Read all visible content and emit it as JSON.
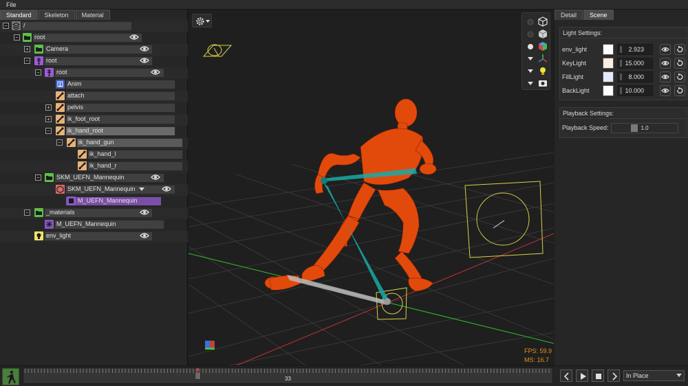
{
  "menu": {
    "file": "File"
  },
  "left_panel": {
    "tabs": [
      "Standard",
      "Skeleton",
      "Material"
    ],
    "tree": [
      {
        "label": "/",
        "icon": "layers-icon",
        "depth": 0
      },
      {
        "label": "root",
        "icon": "folder-icon",
        "depth": 1,
        "visible_toggle": true
      },
      {
        "label": "Camera",
        "icon": "folder-icon",
        "depth": 2,
        "visible_toggle": true
      },
      {
        "label": "root",
        "icon": "skeleton-icon",
        "depth": 2,
        "visible_toggle": true
      },
      {
        "label": "root",
        "icon": "skeleton-icon",
        "depth": 3,
        "visible_toggle": true
      },
      {
        "label": "Anim",
        "icon": "animation-icon",
        "depth": 4
      },
      {
        "label": "attach",
        "icon": "bone-icon",
        "depth": 4
      },
      {
        "label": "pelvis",
        "icon": "bone-icon",
        "depth": 4
      },
      {
        "label": "ik_foot_root",
        "icon": "bone-icon",
        "depth": 4
      },
      {
        "label": "ik_hand_root",
        "icon": "bone-icon",
        "depth": 4
      },
      {
        "label": "ik_hand_gun",
        "icon": "bone-icon",
        "depth": 5
      },
      {
        "label": "ik_hand_l",
        "icon": "bone-icon",
        "depth": 6
      },
      {
        "label": "ik_hand_r",
        "icon": "bone-icon",
        "depth": 6
      },
      {
        "label": "SKM_UEFN_Mannequin",
        "icon": "folder-icon",
        "depth": 3,
        "visible_toggle": true
      },
      {
        "label": "SKM_UEFN_Mannequin",
        "icon": "mesh-icon",
        "depth": 4,
        "visible_toggle": true
      },
      {
        "label": "M_UEFN_Mannequin",
        "icon": "material-icon",
        "depth": 5
      },
      {
        "label": "_materials",
        "icon": "folder-icon",
        "depth": 2,
        "visible_toggle": true
      },
      {
        "label": "M_UEFN_Mannequin",
        "icon": "material-grid-icon",
        "depth": 3
      },
      {
        "label": "env_light",
        "icon": "light-icon",
        "depth": 2,
        "visible_toggle": true
      }
    ]
  },
  "viewport": {
    "fps": "FPS: 59.9",
    "ms": "MS: 16.7",
    "settings_icon": "gear-icon"
  },
  "right_panel": {
    "tabs": [
      "Detail",
      "Scene"
    ],
    "light_settings": {
      "title": "Light Settings:",
      "lights": [
        {
          "name": "env_light",
          "color": "#ffffff",
          "value": "2.923"
        },
        {
          "name": "KeyLight",
          "color": "#fdeee0",
          "value": "15.000"
        },
        {
          "name": "FillLight",
          "color": "#e6e8fb",
          "value": "8.000"
        },
        {
          "name": "BackLight",
          "color": "#ffffff",
          "value": "10.000"
        }
      ]
    },
    "playback_settings": {
      "title": "Playback Settings:",
      "speed_label": "Playback Speed:",
      "speed_value": "1.0",
      "speed_fraction": 0.4
    }
  },
  "bottom_bar": {
    "frame": "33",
    "mode": "In Place"
  },
  "colors": {
    "accent_orange": "#e8901e",
    "folder_green": "#5fbf4a",
    "skeleton_purple": "#9a5cd6",
    "bone_tan": "#e7b277",
    "mesh_red": "#d96a6a",
    "material_purple": "#8a56c8",
    "light_yellow": "#f2e16a",
    "mannequin_orange": "#e24a0c",
    "bone_teal": "#1aa9a7"
  }
}
